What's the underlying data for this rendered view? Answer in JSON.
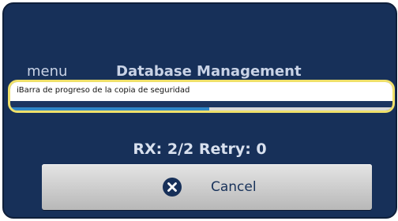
{
  "header": {
    "menu_label": "menu",
    "title": "Database Management"
  },
  "progress": {
    "label": "iBarra de progreso de la copia de seguridad",
    "value": 0.52
  },
  "status": {
    "text": "RX: 2/2 Retry: 0"
  },
  "cancel": {
    "label": "Cancel",
    "icon": "close-icon"
  },
  "colors": {
    "background": "#173059",
    "highlight": "#efe06a",
    "progress_fill": "#2f86c6"
  }
}
